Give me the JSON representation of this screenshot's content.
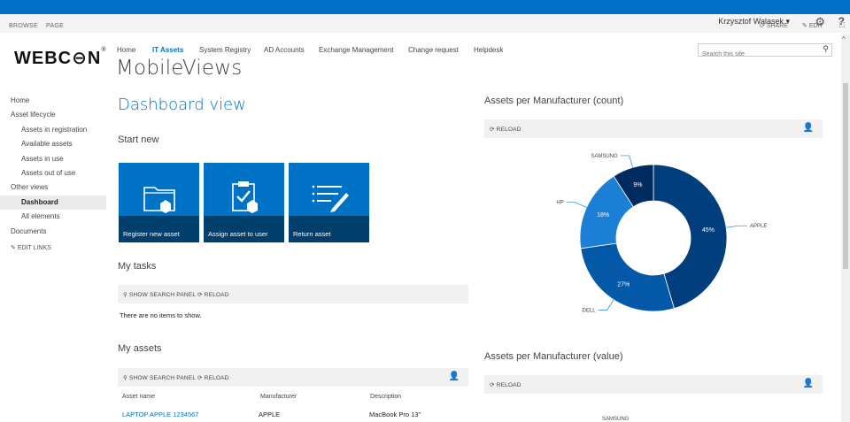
{
  "user": {
    "name": "Krzysztof Walasek ▾"
  },
  "ribbon": {
    "browse": "BROWSE",
    "page": "PAGE",
    "share": "SHARE",
    "edit": "EDIT"
  },
  "logo": {
    "text": "WEBC⊖N",
    "mark": "®"
  },
  "topnav": [
    "Home",
    "IT Assets",
    "System Registry",
    "AD Accounts",
    "Exchange Management",
    "Change request",
    "Helpdesk"
  ],
  "site_title": "MobileViews",
  "search": {
    "placeholder": "Search this site"
  },
  "leftnav": {
    "items": [
      "Home",
      "Asset lifecycle",
      "Assets in registration",
      "Available assets",
      "Assets in use",
      "Assets out of use",
      "Other views",
      "Dashboard",
      "All elements",
      "Documents"
    ],
    "edit_links": "EDIT LINKS"
  },
  "main": {
    "title": "Dashboard view",
    "start_new": "Start new",
    "tiles": [
      "Register new asset",
      "Assign asset to user",
      "Return asset"
    ],
    "my_tasks": "My tasks",
    "show_search_panel": "SHOW SEARCH PANEL",
    "reload": "RELOAD",
    "no_items": "There are no items to show.",
    "my_assets": "My assets",
    "table": {
      "headers": [
        "Asset name",
        "Manufacturer",
        "Description"
      ],
      "rows": [
        [
          "LAPTOP APPLE 1234567",
          "APPLE",
          "MacBook Pro 13\""
        ]
      ]
    }
  },
  "right": {
    "count_title": "Assets per Manufacturer (count)",
    "value_title": "Assets per Manufacturer (value)",
    "reload": "RELOAD",
    "next_label": "SAMSUNG"
  },
  "chart_data": {
    "type": "pie",
    "donut": true,
    "title": "Assets per Manufacturer (count)",
    "categories": [
      "APPLE",
      "DELL",
      "HP",
      "SAMSUNG"
    ],
    "values": [
      45,
      27,
      18,
      9
    ],
    "value_labels": [
      "45%",
      "27%",
      "18%",
      "9%"
    ],
    "colors": [
      "#003e7e",
      "#0458a8",
      "#1b7fd6",
      "#002b61"
    ]
  }
}
